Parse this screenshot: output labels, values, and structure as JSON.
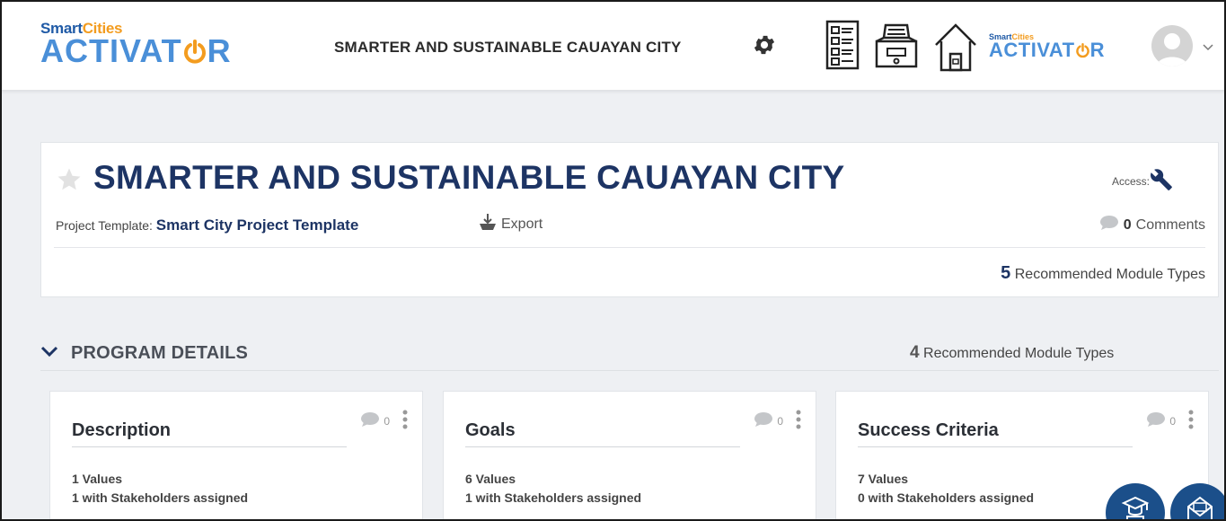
{
  "header": {
    "logo": {
      "small_1": "Smart",
      "small_2": "Cities",
      "big_pre": "ACTIVAT",
      "big_post": "R"
    },
    "project_name": "SMARTER AND SUSTAINABLE CAUAYAN CITY",
    "icons": [
      "checklist-icon",
      "inbox-tray-icon",
      "home-icon"
    ],
    "logo_small": {
      "small_1": "Smart",
      "small_2": "Cities",
      "big_pre": "ACTIVAT",
      "big_post": "R"
    }
  },
  "project": {
    "title": "SMARTER AND SUSTAINABLE CAUAYAN CITY",
    "access_label": "Access:",
    "template_label": "Project Template:",
    "template_name": "Smart City Project Template",
    "export_label": "Export",
    "comments_count": "0",
    "comments_label": "Comments",
    "recommended_count": "5",
    "recommended_label": "Recommended Module Types"
  },
  "section": {
    "title": "PROGRAM DETAILS",
    "recommended_count": "4",
    "recommended_label": "Recommended Module Types"
  },
  "cards": [
    {
      "title": "Description",
      "comment_count": "0",
      "values_line": "1 Values",
      "stakeholders_line": "1 with Stakeholders assigned"
    },
    {
      "title": "Goals",
      "comment_count": "0",
      "values_line": "6 Values",
      "stakeholders_line": "1 with Stakeholders assigned"
    },
    {
      "title": "Success Criteria",
      "comment_count": "0",
      "values_line": "7 Values",
      "stakeholders_line": "0 with Stakeholders assigned"
    }
  ],
  "colors": {
    "brand_navy": "#1d3464",
    "brand_blue": "#4a8fd8",
    "brand_orange": "#f39c1f",
    "fab_blue": "#1b4f8a"
  }
}
